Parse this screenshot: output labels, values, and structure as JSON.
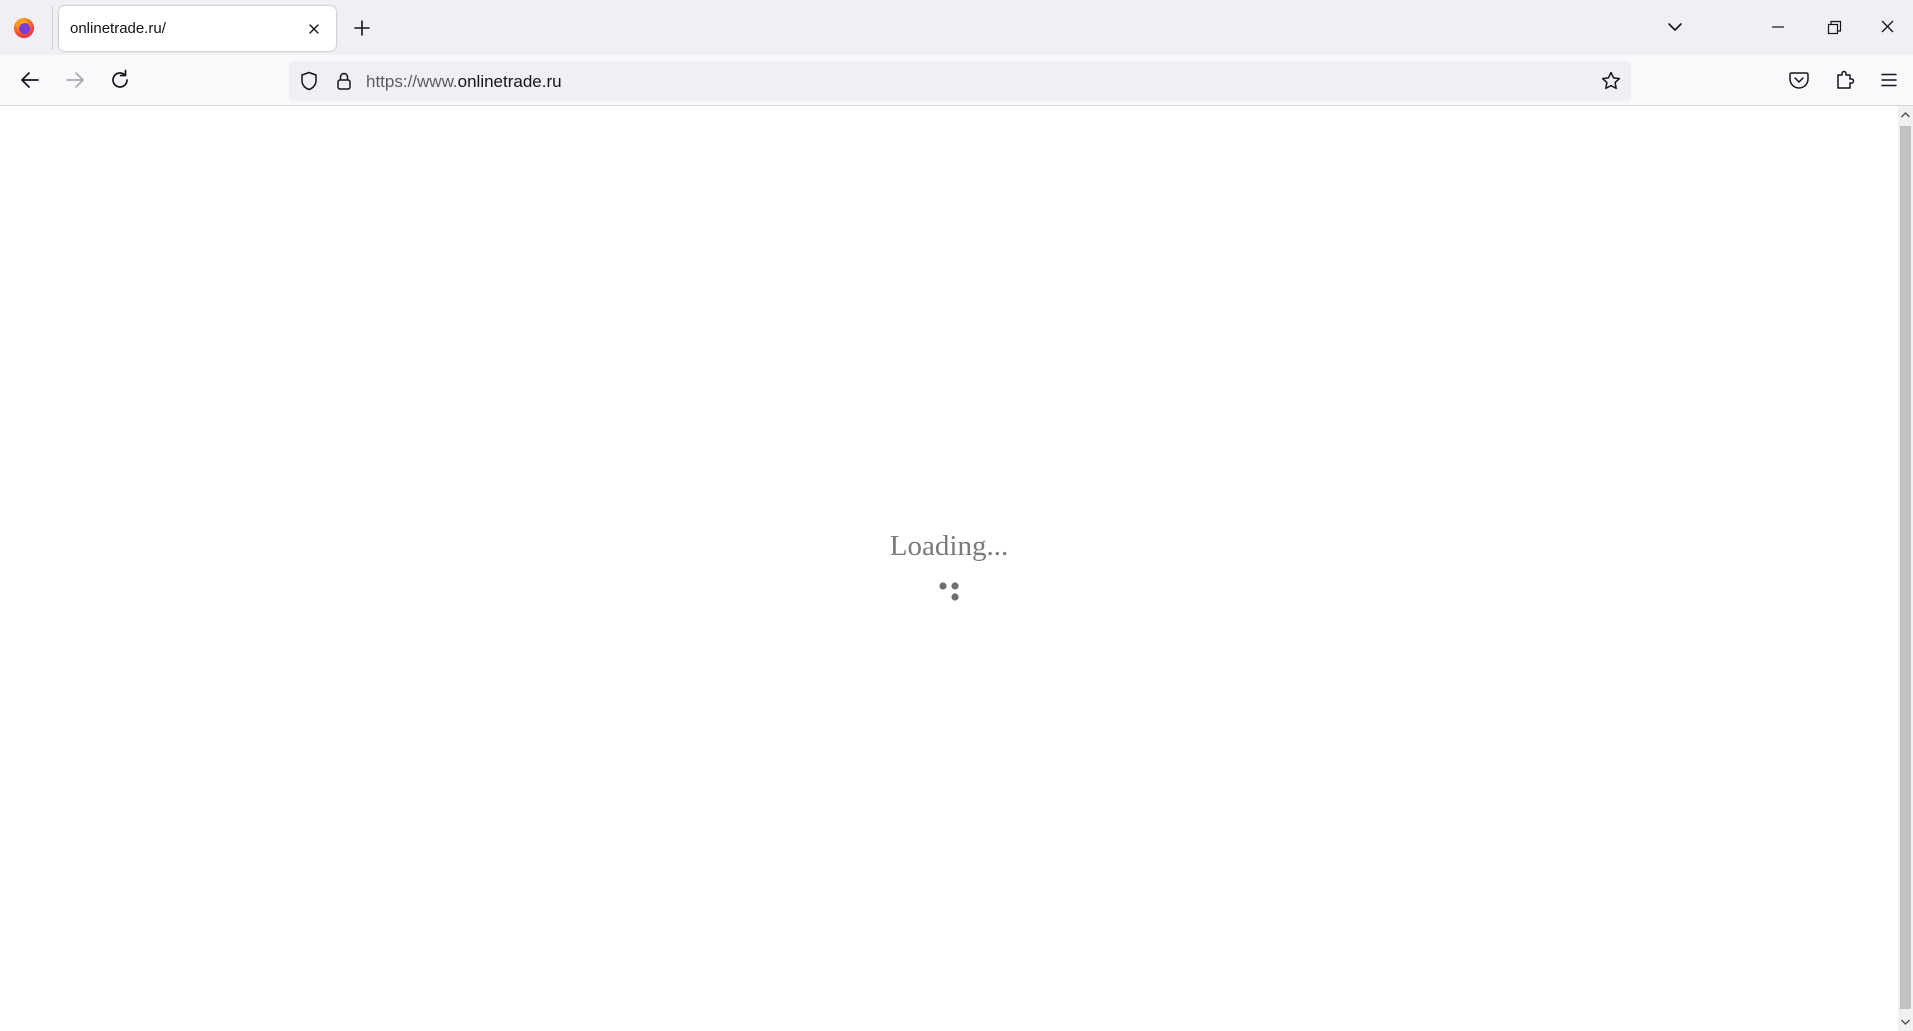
{
  "browser": {
    "tab": {
      "title": "onlinetrade.ru/",
      "close_icon": "close-icon"
    },
    "new_tab_icon": "plus-icon",
    "list_tabs_icon": "chevron-down-icon",
    "window_controls": [
      "minimize-icon",
      "restore-icon",
      "close-icon"
    ]
  },
  "navbar": {
    "back_icon": "arrow-left-icon",
    "forward_icon": "arrow-right-icon",
    "reload_icon": "reload-icon",
    "url": {
      "prefix": "https://www.",
      "domain": "onlinetrade.ru"
    },
    "tools": [
      "pocket-icon",
      "extensions-icon",
      "menu-icon"
    ]
  },
  "page": {
    "loading_text": "Loading..."
  },
  "colors": {
    "tabstrip_bg": "#f0f0f4",
    "navbar_bg": "#f9f9fb",
    "loading_text": "#7a7a7a",
    "spinner": "#6e6e6e"
  }
}
